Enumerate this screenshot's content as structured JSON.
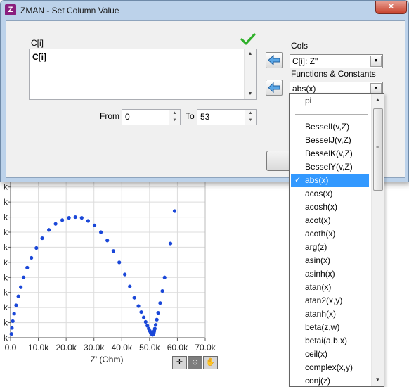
{
  "dialog": {
    "title": "ZMAN - Set Column Value",
    "icon_letter": "Z",
    "close_label": "✕",
    "formula_label": "C[i] =",
    "formula_value": "C[i]",
    "check_icon": "green-check-icon",
    "cols_label": "Cols",
    "cols_value": "C[i]: Z\"",
    "functions_label": "Functions & Constants",
    "functions_value": "abs(x)",
    "from_label": "From",
    "from_value": "0",
    "to_label": "To",
    "to_value": "53"
  },
  "dropdown": {
    "constants": [
      "pi"
    ],
    "items": [
      "BesselI(v,Z)",
      "BesselJ(v,Z)",
      "BesselK(v,Z)",
      "BesselY(v,Z)",
      "abs(x)",
      "acos(x)",
      "acosh(x)",
      "acot(x)",
      "acoth(x)",
      "arg(z)",
      "asin(x)",
      "asinh(x)",
      "atan(x)",
      "atan2(x,y)",
      "atanh(x)",
      "beta(z,w)",
      "betai(a,b,x)",
      "ceil(x)",
      "complex(x,y)",
      "conj(z)"
    ],
    "selected": "abs(x)"
  },
  "background_toolbar": {
    "tools": [
      "crosshair-icon",
      "zoom-icon",
      "pan-hand-icon"
    ]
  },
  "chart_data": {
    "type": "scatter",
    "xlabel": "Z' (Ohm)",
    "x_ticks": [
      "0.0",
      "10.0k",
      "20.0k",
      "30.0k",
      "40.0k",
      "50.0k",
      "60.0k",
      "70.0k"
    ],
    "y_tick_suffix": "k",
    "xlim": [
      0,
      70000
    ],
    "ylim": [
      0,
      21000
    ],
    "grid": true,
    "series_color": "#1a47d8",
    "points": [
      [
        300,
        500
      ],
      [
        480,
        1300
      ],
      [
        800,
        2200
      ],
      [
        1300,
        3200
      ],
      [
        2000,
        4300
      ],
      [
        2800,
        5500
      ],
      [
        3700,
        6700
      ],
      [
        4700,
        8000
      ],
      [
        6000,
        9300
      ],
      [
        7500,
        10600
      ],
      [
        9300,
        11900
      ],
      [
        11400,
        13200
      ],
      [
        13800,
        14300
      ],
      [
        16200,
        15100
      ],
      [
        18600,
        15600
      ],
      [
        21000,
        15900
      ],
      [
        23300,
        16000
      ],
      [
        25600,
        15900
      ],
      [
        27900,
        15500
      ],
      [
        30200,
        14900
      ],
      [
        32500,
        14000
      ],
      [
        34800,
        12900
      ],
      [
        37000,
        11500
      ],
      [
        39100,
        10000
      ],
      [
        41100,
        8400
      ],
      [
        42900,
        6800
      ],
      [
        44500,
        5300
      ],
      [
        46000,
        4200
      ],
      [
        47000,
        3400
      ],
      [
        47900,
        2700
      ],
      [
        48600,
        2100
      ],
      [
        49200,
        1600
      ],
      [
        49700,
        1200
      ],
      [
        50100,
        900
      ],
      [
        50400,
        700
      ],
      [
        50650,
        550
      ],
      [
        50850,
        460
      ],
      [
        51000,
        420
      ],
      [
        51100,
        400
      ],
      [
        51200,
        420
      ],
      [
        51300,
        480
      ],
      [
        51400,
        570
      ],
      [
        51550,
        700
      ],
      [
        51700,
        900
      ],
      [
        51900,
        1200
      ],
      [
        52200,
        1700
      ],
      [
        52600,
        2400
      ],
      [
        53100,
        3300
      ],
      [
        53800,
        4600
      ],
      [
        54600,
        6200
      ],
      [
        55400,
        8000
      ],
      [
        57500,
        12500
      ],
      [
        59000,
        16800
      ]
    ]
  },
  "colors": {
    "dialog_frame": "#bcd2ea",
    "client_bg": "#f0f0f0",
    "selection": "#3399ff",
    "close_button": "#c8422c",
    "check": "#2fb02a"
  }
}
